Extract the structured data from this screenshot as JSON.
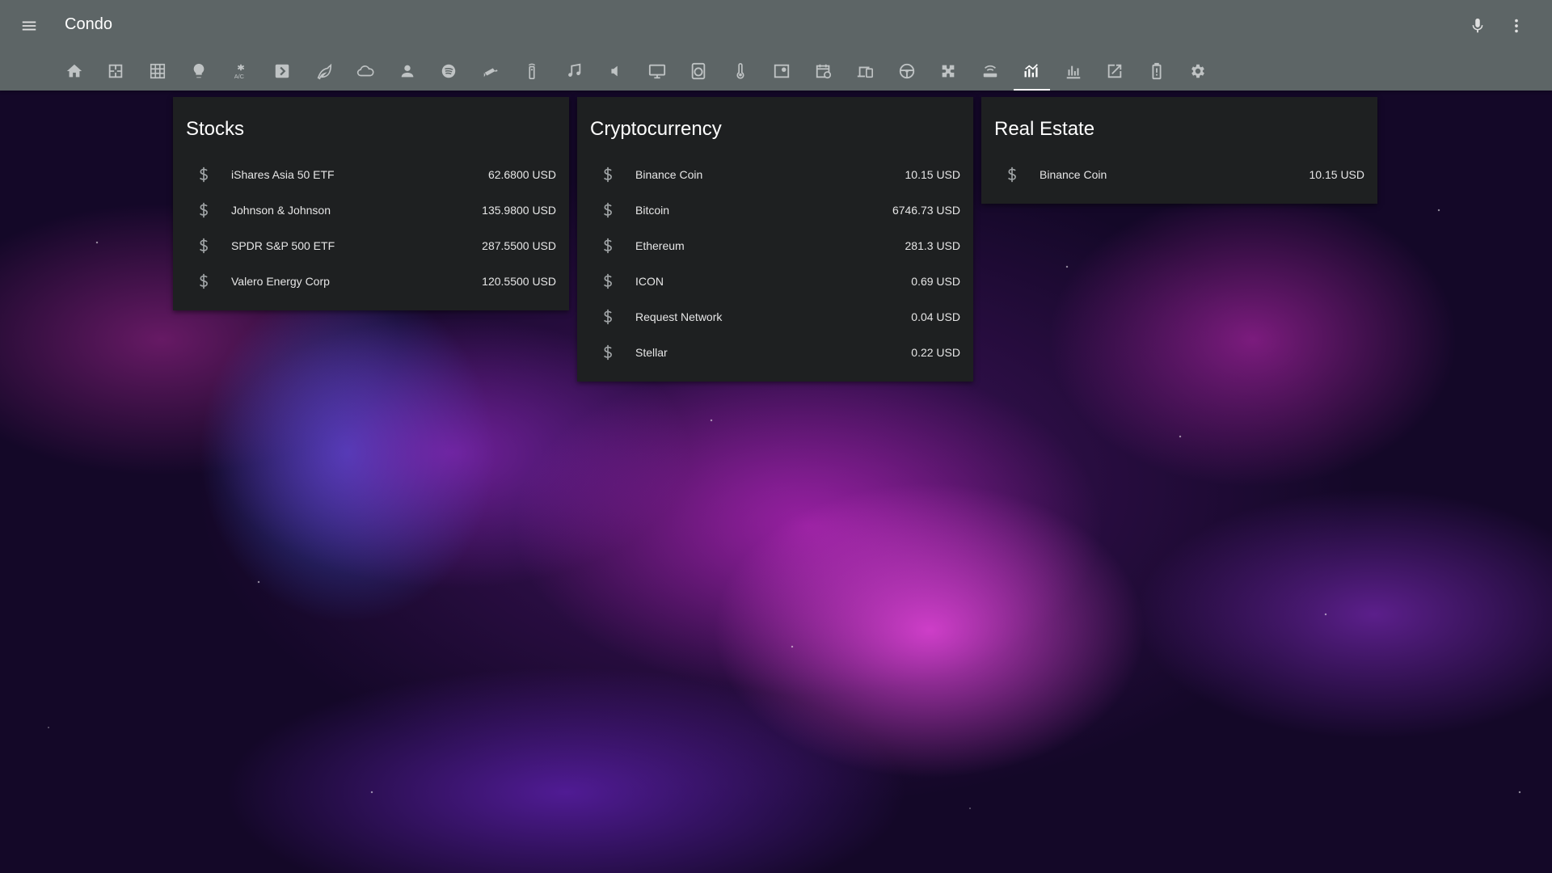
{
  "header": {
    "title": "Condo",
    "menu_icon": "menu-icon",
    "mic_icon": "microphone-icon",
    "more_icon": "more-vertical-icon"
  },
  "colors": {
    "toolbar": "#5d6566",
    "card": "#1e2021",
    "text": "#e6e6e6",
    "icon": "#a0a4a6"
  },
  "tabs": [
    {
      "icon": "home-icon",
      "active": false
    },
    {
      "icon": "floorplan-icon",
      "active": false
    },
    {
      "icon": "grid-icon",
      "active": false
    },
    {
      "icon": "lightbulb-icon",
      "active": false
    },
    {
      "icon": "air-conditioner-icon",
      "active": false
    },
    {
      "icon": "plex-icon",
      "active": false
    },
    {
      "icon": "leaf-icon",
      "active": false
    },
    {
      "icon": "cloud-icon",
      "active": false
    },
    {
      "icon": "person-icon",
      "active": false
    },
    {
      "icon": "spotify-icon",
      "active": false
    },
    {
      "icon": "security-camera-icon",
      "active": false
    },
    {
      "icon": "remote-icon",
      "active": false
    },
    {
      "icon": "music-note-icon",
      "active": false
    },
    {
      "icon": "speaker-icon",
      "active": false
    },
    {
      "icon": "monitor-icon",
      "active": false
    },
    {
      "icon": "washing-machine-icon",
      "active": false
    },
    {
      "icon": "thermometer-icon",
      "active": false
    },
    {
      "icon": "map-icon",
      "active": false
    },
    {
      "icon": "calendar-clock-icon",
      "active": false
    },
    {
      "icon": "devices-icon",
      "active": false
    },
    {
      "icon": "steering-wheel-icon",
      "active": false
    },
    {
      "icon": "puzzle-icon",
      "active": false
    },
    {
      "icon": "router-icon",
      "active": false
    },
    {
      "icon": "finance-icon",
      "active": true
    },
    {
      "icon": "bar-chart-icon",
      "active": false
    },
    {
      "icon": "open-in-new-icon",
      "active": false
    },
    {
      "icon": "battery-alert-icon",
      "active": false
    },
    {
      "icon": "settings-icon",
      "active": false
    }
  ],
  "cards": {
    "stocks": {
      "title": "Stocks",
      "items": [
        {
          "name": "iShares Asia 50 ETF",
          "value": "62.6800 USD",
          "icon": "currency-usd-icon"
        },
        {
          "name": "Johnson & Johnson",
          "value": "135.9800 USD",
          "icon": "currency-usd-icon"
        },
        {
          "name": "SPDR S&P 500 ETF",
          "value": "287.5500 USD",
          "icon": "currency-usd-icon"
        },
        {
          "name": "Valero Energy Corp",
          "value": "120.5500 USD",
          "icon": "currency-usd-icon"
        }
      ]
    },
    "crypto": {
      "title": "Cryptocurrency",
      "items": [
        {
          "name": "Binance Coin",
          "value": "10.15 USD",
          "icon": "currency-usd-icon"
        },
        {
          "name": "Bitcoin",
          "value": "6746.73 USD",
          "icon": "currency-usd-icon"
        },
        {
          "name": "Ethereum",
          "value": "281.3 USD",
          "icon": "currency-usd-icon"
        },
        {
          "name": "ICON",
          "value": "0.69 USD",
          "icon": "currency-usd-icon"
        },
        {
          "name": "Request Network",
          "value": "0.04 USD",
          "icon": "currency-usd-icon"
        },
        {
          "name": "Stellar",
          "value": "0.22 USD",
          "icon": "currency-usd-icon"
        }
      ]
    },
    "real_estate": {
      "title": "Real Estate",
      "items": [
        {
          "name": "Binance Coin",
          "value": "10.15 USD",
          "icon": "currency-usd-icon"
        }
      ]
    }
  }
}
